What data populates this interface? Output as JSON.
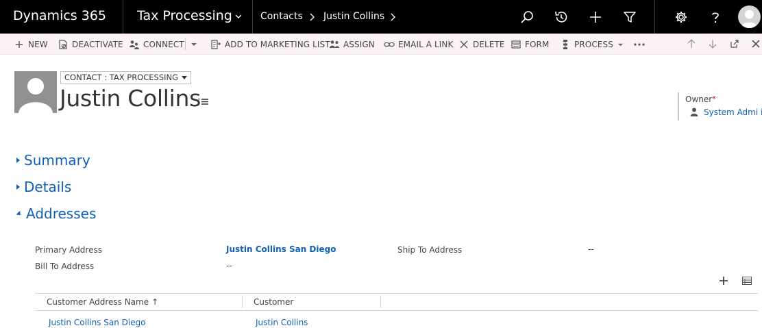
{
  "topnav": {
    "brand": "Dynamics 365",
    "area": "Tax Processing",
    "breadcrumbs": [
      "Contacts",
      "Justin Collins"
    ],
    "icons": [
      "search-icon",
      "history-icon",
      "plus-icon",
      "filter-icon",
      "gear-icon",
      "help-icon",
      "user-avatar"
    ]
  },
  "commandbar": {
    "new": "NEW",
    "deactivate": "DEACTIVATE",
    "connect": "CONNECT",
    "add_to_marketing_list": "ADD TO MARKETING LIST",
    "assign": "ASSIGN",
    "email_a_link": "EMAIL A LINK",
    "delete": "DELETE",
    "form": "FORM",
    "process": "PROCESS"
  },
  "header": {
    "form_selector": "CONTACT : TAX PROCESSING",
    "entity_name": "Justin Collins",
    "owner_label": "Owner",
    "owner_required": "*",
    "owner_value": "System Admi   i"
  },
  "sections": {
    "summary": "Summary",
    "details": "Details",
    "addresses": "Addresses"
  },
  "addresses": {
    "primary_address_label": "Primary Address",
    "primary_address_value": "Justin Collins San Diego",
    "ship_to_label": "Ship To Address",
    "ship_to_value": "--",
    "bill_to_label": "Bill To Address",
    "bill_to_value": "--"
  },
  "grid": {
    "columns": [
      "Customer Address Name",
      "Customer"
    ],
    "sort_indicator": "↑",
    "rows": [
      {
        "name": "Justin Collins San Diego",
        "customer": "Justin Collins"
      }
    ]
  },
  "colors": {
    "nav_bg": "#000000",
    "cmdbar_bg": "#fbf3f3",
    "link": "#1160b7",
    "required": "#c00000"
  }
}
